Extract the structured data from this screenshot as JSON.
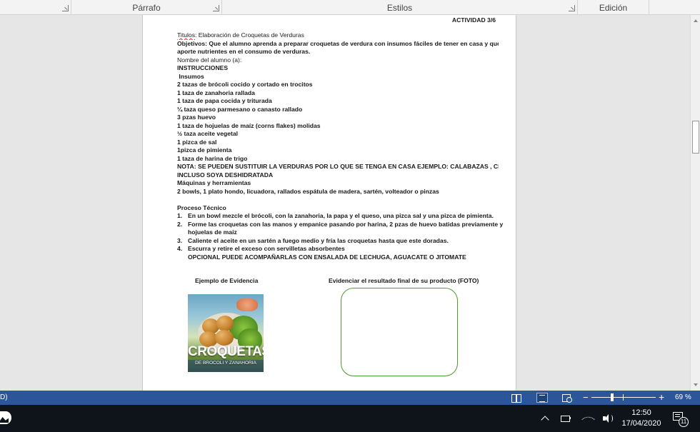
{
  "ribbon": {
    "groups": [
      "Párrafo",
      "Estilos",
      "Edición"
    ]
  },
  "document": {
    "activity": "ACTIVIDAD 3/6",
    "titulos_word": "Titulos",
    "titulo_rest": ": Elaboración de Croquetas de Verduras",
    "objetivos_1": "Objetivos: Que el alumno aprenda a preparar croquetas de verdura con insumos fáciles de tener en casa y que les",
    "objetivos_2": "aporte nutrientes en el consumo de verduras.",
    "nombre": "Nombre del alumno (a):",
    "instrucciones": "INSTRUCCIONES",
    "insumos": " Insumos",
    "ingredients": [
      "2 tazas de brócoli cocido y cortado en trocitos",
      "1 taza de zanahoria rallada",
      "1 taza de papa cocida y triturada",
      "¼ taza queso parmesano o canasto rallado",
      "3 pzas huevo",
      "1 taza de hojuelas de maíz (corns flakes) molidas",
      "½ taza aceite vegetal",
      "1 pizca de sal",
      "1pizca de pimienta",
      "1 taza de harina de trigo"
    ],
    "nota_1": "NOTA: SE PUEDEN SUSTITUIR LA VERDURAS POR LO QUE SE TENGA EN CASA EJEMPLO: CALABAZAS , CHAYOTES O",
    "nota_2": "INCLUSO SOYA DESHIDRATADA",
    "maquinas": "Máquinas y herramientas",
    "maquinas_list": "2 bowls, 1 plato hondo, licuadora, rallados espátula de madera, sartén, volteador o pinzas",
    "proceso": "Proceso Técnico",
    "steps": [
      {
        "n": "1.",
        "text": "En un bowl mezcle el brócoli, con la zanahoria, la papa y el queso, una pizca sal y una pizca de pimienta."
      },
      {
        "n": "2.",
        "text": "Forme las croquetas con las manos y empanice pasando por harina, 2 pzas de huevo batidas previamente y",
        "cont": "hojuelas de maiz"
      },
      {
        "n": "3.",
        "text": "Caliente el aceite en un sartén a fuego medio y fría las croquetas hasta que este doradas."
      },
      {
        "n": "4.",
        "text": "Escurra y retire el exceso con servilletas absorbentes",
        "cont": "OPCIONAL PUEDE ACOMPAÑARLAS CON ENSALADA DE LECHUGA, AGUACATE O JITOMATE"
      }
    ],
    "ejemplo": "Ejemplo de Evidencia",
    "evidenciar": "Evidenciar el resultado final de su producto (FOTO)",
    "photo_title": "CROQUETAS",
    "photo_subtitle": "DE BROCOLI Y ZANAHORIA"
  },
  "statusbar": {
    "left": "D)",
    "zoom": "69 %",
    "zoom_level_percent": 69,
    "minus": "−",
    "plus": "+"
  },
  "taskbar": {
    "time": "12:50",
    "date": "17/04/2020",
    "notifications": "11"
  },
  "colors": {
    "statusbar": "#2b579a",
    "taskbar": "#0e1419",
    "frame_border": "#4f9a2e"
  }
}
